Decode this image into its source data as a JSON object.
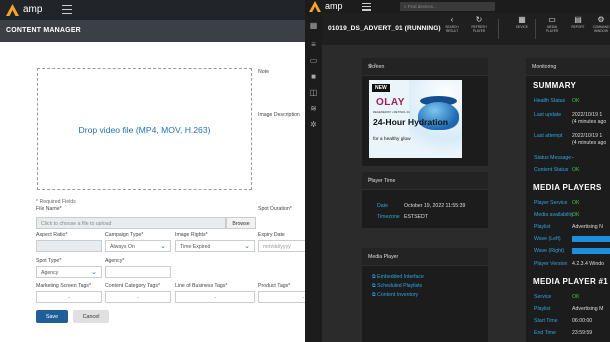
{
  "left": {
    "app_name": "amp",
    "page_title": "CONTENT MANAGER",
    "dropzone_text": "Drop video file (MP4, MOV, H.263)",
    "note_label": "Note",
    "image_description_label": "Image Description",
    "required_note": "* Required Fields",
    "file_name_label": "File Name*",
    "file_placeholder": "Click to choose a file to upload",
    "browse_label": "Browse",
    "spot_duration_label": "Spot Duration*",
    "aspect_ratio_label": "Aspect Ratio*",
    "campaign_type_label": "Campaign Type*",
    "campaign_type_value": "Always On",
    "image_rights_label": "Image Rights*",
    "image_rights_value": "Time Expired",
    "expiry_date_label": "Expiry Date",
    "expiry_date_placeholder": "mm/dd/yyyy",
    "spot_type_label": "Spot Type*",
    "spot_type_value": "Agency",
    "agency_label": "Agency*",
    "marketing_screen_tags_label": "Marketing Screen Tags*",
    "content_category_tags_label": "Content Category Tags*",
    "line_of_business_tags_label": "Line of Business Tags*",
    "product_tags_label": "Product Tags*",
    "tag_dash": "-",
    "save_label": "Save",
    "cancel_label": "Cancel"
  },
  "right": {
    "app_name": "amp",
    "search_placeholder": "Find devices...",
    "device_name": "01019_DS_ADVERT_01 (RUNNING)",
    "toolbar": [
      {
        "label": "SEARCH RESULT",
        "glyph": "‹"
      },
      {
        "label": "REFRESH PLAYER",
        "glyph": "↻"
      },
      {
        "label": "DEVICE",
        "glyph": "▦"
      },
      {
        "label": "MEDIA PLAYER",
        "glyph": "▭"
      },
      {
        "label": "REPORT",
        "glyph": "▤"
      },
      {
        "label": "COMMAND WINDOW",
        "glyph": "⚙"
      }
    ],
    "screen_card_title": "Screen",
    "ad": {
      "badge": "NEW",
      "brand": "OLAY",
      "subbrand": "REGENERIST • RETINOL 24",
      "headline": "24-Hour Hydration",
      "tagline": "for a healthy glow"
    },
    "player_time_title": "Player Time",
    "date_label": "Date",
    "date_value": "October 19, 2022 11:55:39",
    "timezone_label": "Timezone",
    "timezone_value": "ESTSEDT",
    "media_player_title": "Media Player",
    "links": [
      "Embedded Interface",
      "Scheduled Playlists",
      "Content Inventory"
    ],
    "monitoring_title": "Monitoring",
    "summary_header": "SUMMARY",
    "summary_rows": [
      {
        "key": "Health Status",
        "value": "OK",
        "ok": true
      },
      {
        "key": "Last update",
        "value": "2022/10/19 1",
        "value2": "(4 minutes ago"
      },
      {
        "key": "Last attempt",
        "value": "2022/10/19 1",
        "value2": "(4 minutes ago"
      },
      {
        "key": "Status Message",
        "value": "-"
      },
      {
        "key": "Content Status",
        "value": "OK",
        "ok": true
      }
    ],
    "media_players_header": "MEDIA PLAYERS",
    "media_players_rows": [
      {
        "key": "Player Service",
        "value": "OK",
        "ok": true
      },
      {
        "key": "Media availability",
        "value": "OK",
        "ok": true
      },
      {
        "key": "Playlist",
        "value": "Advertising N"
      },
      {
        "key": "Wave (Left)",
        "value": ""
      },
      {
        "key": "Wave (Right)",
        "value": ""
      },
      {
        "key": "Player Version",
        "value": "4.2.3.4 Windo"
      }
    ],
    "media_player1_header": "MEDIA PLAYER #1",
    "media_player1_rows": [
      {
        "key": "Service",
        "value": "OK",
        "ok": true
      },
      {
        "key": "Playlist",
        "value": "Advertising M"
      },
      {
        "key": "Start Time",
        "value": "06:00:00"
      },
      {
        "key": "End Time",
        "value": "23:59:59"
      }
    ]
  },
  "colors": {
    "dark_bg": "#2b2b2b",
    "card_bg": "#1c1c1c",
    "accent_blue": "#2aa7e0",
    "ok_green": "#3ec63e",
    "save_blue": "#1f5f99",
    "logo_orange": "#f5a623"
  }
}
